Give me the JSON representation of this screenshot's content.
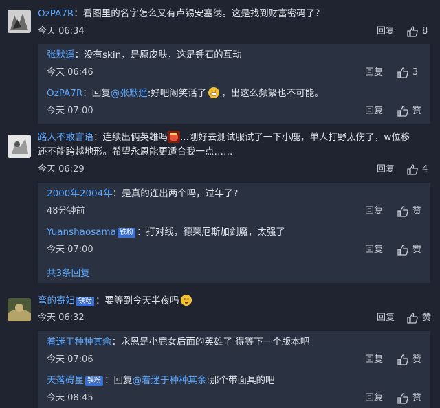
{
  "colors": {
    "accent": "#5aa6ff",
    "background": "#1f2430",
    "subbox": "#2a3140",
    "badge": "#3b6fd1"
  },
  "actions": {
    "reply_label": "回复",
    "like_label": "赞"
  },
  "comments": [
    {
      "user": "OzPA7R",
      "text": "看图里的名字怎么又有卢锡安塞纳。这是找到财富密码了？",
      "time": "今天 06:34",
      "likes": "8",
      "replies": [
        {
          "user": "张默遥",
          "text": "没有skin，是原皮肤，这是锤石的互动",
          "time": "今天 06:46",
          "likes": "3"
        },
        {
          "user": "OzPA7R",
          "pre": "回复",
          "mention": "@张默遥",
          "text": "好吧闹笑话了",
          "emoji": "grin-emoji",
          "text2": "，出这么频繁也不可能。",
          "time": "今天 07:00",
          "likes": "赞"
        }
      ]
    },
    {
      "user": "路人不敢言语",
      "text_line1_a": "连续出俩英雄吗",
      "text_line1_b": "...刚好去测试服试了一下小鹿，单人打野太伤了，w位移",
      "text_line2": "还不能跨越地形。希望永恩能更适合我一点……",
      "time": "今天 06:29",
      "likes": "4",
      "replies": [
        {
          "user": "2000年2004年",
          "text": "是真的连出两个吗，过年了?",
          "time": "48分钟前",
          "likes": "赞"
        },
        {
          "user": "Yuanshaosama",
          "badge": "铁粉",
          "text": "打对线，德莱厄斯加剑魔，太强了",
          "time": "今天 07:00",
          "likes": "赞"
        }
      ],
      "more": "共3条回复"
    },
    {
      "user": "弯的寄妇",
      "badge": "铁粉",
      "text": "要等到今天半夜吗",
      "time": "今天 06:32",
      "likes": "赞",
      "replies": [
        {
          "user": "着迷于种种其余",
          "text": "永恩是小鹿女后面的英雄了 得等下一个版本吧",
          "time": "今天 07:06",
          "likes": "赞"
        },
        {
          "user": "天落碍星",
          "badge": "铁粉",
          "pre": "回复",
          "mention": "@着迷于种种其余",
          "text": "那个带面具的吧",
          "time": "今天 08:45",
          "likes": "赞"
        }
      ]
    }
  ]
}
